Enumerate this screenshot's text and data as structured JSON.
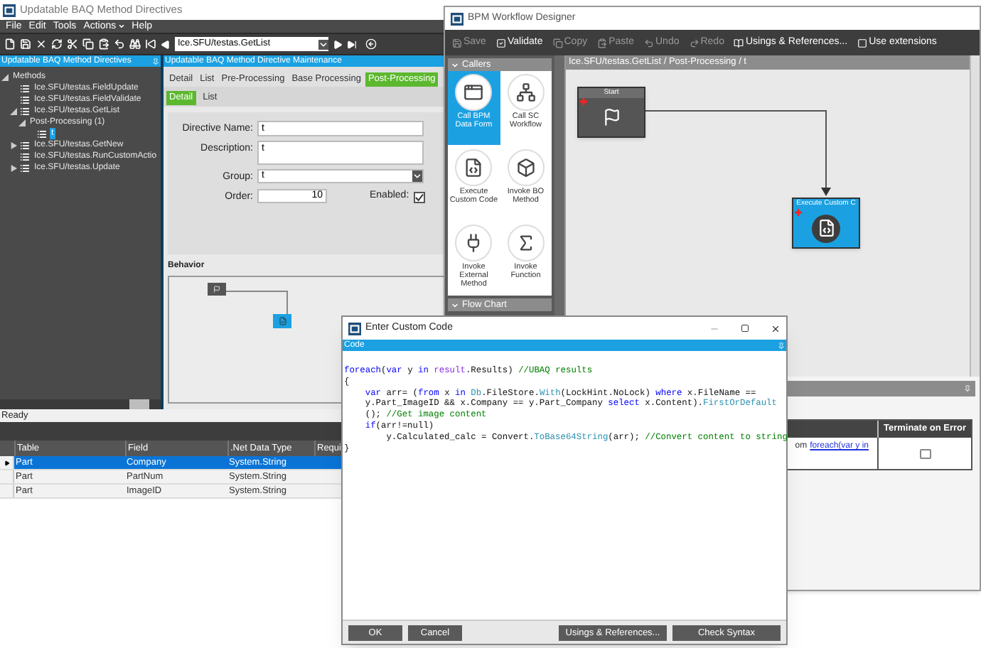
{
  "main_window": {
    "title": "Updatable BAQ Method Directives",
    "menu": [
      {
        "label": "File",
        "caret": false
      },
      {
        "label": "Edit",
        "caret": false
      },
      {
        "label": "Tools",
        "caret": false
      },
      {
        "label": "Actions",
        "caret": true
      },
      {
        "label": "Help",
        "caret": false
      }
    ],
    "record": "Ice.SFU/testas.GetList",
    "tree_panel": {
      "title": "Updatable BAQ Method Directives",
      "items": [
        {
          "label": "Methods",
          "expanded": true,
          "selected": false,
          "children": [
            {
              "label": "Ice.SFU/testas.FieldUpdate",
              "selected": false,
              "kind": "method"
            },
            {
              "label": "Ice.SFU/testas.FieldValidate",
              "selected": false,
              "kind": "method"
            },
            {
              "label": "Ice.SFU/testas.GetList",
              "expanded": true,
              "selected": false,
              "kind": "method",
              "children": [
                {
                  "label": "Post-Processing (1)",
                  "expanded": true,
                  "selected": false,
                  "children": [
                    {
                      "label": "t",
                      "selected": true,
                      "kind": "directive"
                    }
                  ]
                }
              ]
            },
            {
              "label": "Ice.SFU/testas.GetNew",
              "expanded": false,
              "selected": false,
              "kind": "method"
            },
            {
              "label": "Ice.SFU/testas.RunCustomActio",
              "selected": false,
              "kind": "method"
            },
            {
              "label": "Ice.SFU/testas.Update",
              "expanded": false,
              "selected": false,
              "kind": "method"
            }
          ]
        }
      ]
    },
    "maintenance_panel": {
      "title": "Updatable BAQ Method Directive Maintenance",
      "tabs": [
        {
          "label": "Detail",
          "selected": false
        },
        {
          "label": "List",
          "selected": false
        },
        {
          "label": "Pre-Processing",
          "selected": false
        },
        {
          "label": "Base Processing",
          "selected": false
        },
        {
          "label": "Post-Processing",
          "selected": true
        }
      ],
      "subtabs": [
        {
          "label": "Detail",
          "selected": true
        },
        {
          "label": "List",
          "selected": false
        }
      ],
      "form": {
        "directive_name": {
          "label": "Directive Name:",
          "value": "t"
        },
        "description": {
          "label": "Description:",
          "value": "t"
        },
        "group": {
          "label": "Group:",
          "value": "t"
        },
        "order": {
          "label": "Order:",
          "value": "10"
        },
        "enabled": {
          "label": "Enabled:",
          "checked": true
        }
      },
      "behavior_label": "Behavior"
    },
    "status_bar": "Ready"
  },
  "fields_grid": {
    "columns": [
      "Table",
      "Field",
      ".Net Data Type",
      "Requi"
    ],
    "rows": [
      {
        "cells": [
          "Part",
          "Company",
          "System.String"
        ],
        "selected": true
      },
      {
        "cells": [
          "Part",
          "PartNum",
          "System.String"
        ],
        "selected": false
      },
      {
        "cells": [
          "Part",
          "ImageID",
          "System.String"
        ],
        "selected": false
      }
    ]
  },
  "bpm_designer": {
    "title": "BPM Workflow Designer",
    "toolbar": [
      {
        "label": "Save",
        "kind": "save",
        "disabled": true
      },
      {
        "label": "Validate",
        "kind": "validate",
        "disabled": false
      },
      {
        "label": "Copy",
        "kind": "copy",
        "disabled": true
      },
      {
        "label": "Paste",
        "kind": "paste",
        "disabled": true
      },
      {
        "label": "Undo",
        "kind": "undo",
        "disabled": true
      },
      {
        "label": "Redo",
        "kind": "redo",
        "disabled": true
      },
      {
        "label": "Usings & References...",
        "kind": "references",
        "disabled": false
      },
      {
        "label": "Use extensions",
        "kind": "extensions",
        "disabled": false
      }
    ],
    "palette": {
      "sections": [
        {
          "title": "Callers",
          "items": [
            {
              "label": "Call BPM Data Form",
              "kind": "form",
              "selected": true
            },
            {
              "label": "Call SC Workflow",
              "kind": "workflow",
              "selected": false
            },
            {
              "label": "Execute Custom Code",
              "kind": "code",
              "selected": false
            },
            {
              "label": "Invoke BO Method",
              "kind": "bo",
              "selected": false
            },
            {
              "label": "Invoke External Method",
              "kind": "external",
              "selected": false
            },
            {
              "label": "Invoke Function",
              "kind": "function",
              "selected": false
            }
          ]
        },
        {
          "title": "Flow Chart"
        }
      ]
    },
    "breadcrumb": "Ice.SFU/testas.GetList / Post-Processing / t",
    "nodes": [
      {
        "title": "Start",
        "kind": "start"
      },
      {
        "title": "Execute Custom C",
        "kind": "code"
      }
    ],
    "properties_grid": {
      "columns": [
        "Terminate on Error"
      ],
      "row": {
        "text": "om",
        "link": "foreach(var y in",
        "terminate_on_error": false
      }
    }
  },
  "code_dialog": {
    "title": "Enter Custom Code",
    "section": "Code",
    "lines": [
      [
        {
          "text": "foreach",
          "kind": "keyword"
        },
        {
          "text": "(",
          "kind": "plain"
        },
        {
          "text": "var",
          "kind": "keyword"
        },
        {
          "text": " y ",
          "kind": "plain"
        },
        {
          "text": "in",
          "kind": "keyword"
        },
        {
          "text": " result",
          "kind": "variable"
        },
        {
          "text": ".Results) ",
          "kind": "plain"
        },
        {
          "text": "//UBAQ results",
          "kind": "comment"
        }
      ],
      [
        {
          "text": "{",
          "kind": "plain"
        }
      ],
      [
        {
          "text": "    var",
          "kind": "keyword"
        },
        {
          "text": " arr= (",
          "kind": "plain"
        },
        {
          "text": "from",
          "kind": "keyword"
        },
        {
          "text": " x ",
          "kind": "plain"
        },
        {
          "text": "in",
          "kind": "keyword"
        },
        {
          "text": " Db",
          "kind": "type"
        },
        {
          "text": ".FileStore.",
          "kind": "plain"
        },
        {
          "text": "With",
          "kind": "type"
        },
        {
          "text": "(LockHint.NoLock) ",
          "kind": "plain"
        },
        {
          "text": "where",
          "kind": "keyword"
        },
        {
          "text": " x.FileName ==",
          "kind": "plain"
        }
      ],
      [
        {
          "text": "    y.Part_ImageID && x.Company == y.Part_Company ",
          "kind": "plain"
        },
        {
          "text": "select",
          "kind": "keyword"
        },
        {
          "text": " x.Content).",
          "kind": "plain"
        },
        {
          "text": "FirstOrDefault",
          "kind": "type"
        }
      ],
      [
        {
          "text": "    (); ",
          "kind": "plain"
        },
        {
          "text": "//Get image content",
          "kind": "comment"
        }
      ],
      [
        {
          "text": "    if",
          "kind": "keyword"
        },
        {
          "text": "(arr!=null)",
          "kind": "plain"
        }
      ],
      [
        {
          "text": "        y.Calculated_calc = Convert.",
          "kind": "plain"
        },
        {
          "text": "ToBase64String",
          "kind": "type"
        },
        {
          "text": "(arr); ",
          "kind": "plain"
        },
        {
          "text": "//Convert content to string",
          "kind": "comment"
        }
      ],
      [
        {
          "text": "}",
          "kind": "plain"
        }
      ]
    ],
    "buttons": [
      {
        "label": "OK",
        "kind": "ok"
      },
      {
        "label": "Cancel",
        "kind": "cancel"
      },
      {
        "label": "Usings & References...",
        "kind": "usings"
      },
      {
        "label": "Check Syntax",
        "kind": "check"
      }
    ]
  }
}
